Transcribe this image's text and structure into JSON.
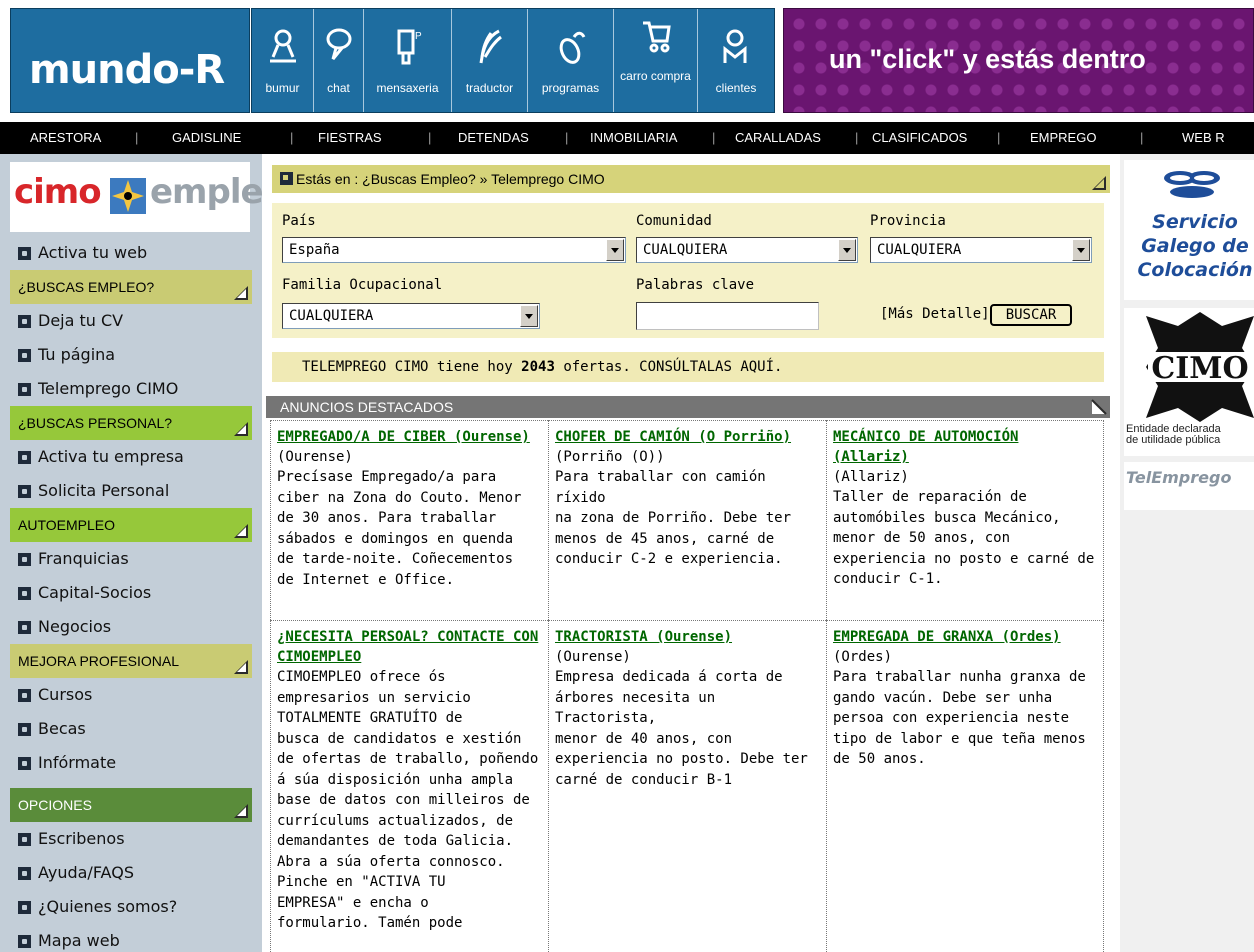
{
  "header": {
    "logo": "mundo-R",
    "apps": [
      {
        "label": "bumur",
        "icon": "microscope-icon"
      },
      {
        "label": "chat",
        "icon": "chat-balloon-icon"
      },
      {
        "label": "mensaxeria",
        "icon": "pager-icon"
      },
      {
        "label": "traductor",
        "icon": "quill-icon"
      },
      {
        "label": "programas",
        "icon": "mouse-icon"
      },
      {
        "label": "carro compra",
        "icon": "shopping-cart-icon"
      },
      {
        "label": "clientes",
        "icon": "customer-icon"
      }
    ],
    "banner": "un \"click\" y estás dentro"
  },
  "nav": [
    "ARESTORA",
    "GADISLINE",
    "FIESTRAS",
    "DETENDAS",
    "INMOBILIARIA",
    "CARALLADAS",
    "CLASIFICADOS",
    "EMPREGO",
    "WEB R"
  ],
  "sidebar": {
    "logo_left": "cimo",
    "logo_right": "empleo",
    "items": [
      {
        "type": "link",
        "label": "Activa tu web"
      },
      {
        "type": "head",
        "label": "¿BUSCAS EMPLEO?",
        "style": "olive"
      },
      {
        "type": "link",
        "label": "Deja tu CV"
      },
      {
        "type": "link",
        "label": "Tu página"
      },
      {
        "type": "link",
        "label": "Telempregо CIMO"
      },
      {
        "type": "head",
        "label": "¿BUSCAS PERSONAL?",
        "style": "green"
      },
      {
        "type": "link",
        "label": "Activa tu empresa"
      },
      {
        "type": "link",
        "label": "Solicita Personal"
      },
      {
        "type": "head",
        "label": "AUTOEMPLEO",
        "style": "green"
      },
      {
        "type": "link",
        "label": "Franquicias"
      },
      {
        "type": "link",
        "label": "Capital-Socios"
      },
      {
        "type": "link",
        "label": "Negocios"
      },
      {
        "type": "head",
        "label": "MEJORA PROFESIONAL",
        "style": "olive"
      },
      {
        "type": "link",
        "label": "Cursos"
      },
      {
        "type": "link",
        "label": "Becas"
      },
      {
        "type": "link",
        "label": "Infórmate"
      },
      {
        "type": "head",
        "label": "OPCIONES",
        "style": "dkgreen"
      },
      {
        "type": "link",
        "label": "Escribenos"
      },
      {
        "type": "link",
        "label": "Ayuda/FAQS"
      },
      {
        "type": "link",
        "label": "¿Quienes somos?"
      },
      {
        "type": "link",
        "label": "Mapa web"
      }
    ]
  },
  "breadcrumb": "Estás en : ¿Buscas Empleo? » Telempregо CIMO",
  "search": {
    "pais_label": "País",
    "pais_value": "España",
    "comunidad_label": "Comunidad",
    "comunidad_value": "CUALQUIERA",
    "provincia_label": "Provincia",
    "provincia_value": "CUALQUIERA",
    "familia_label": "Familia Ocupacional",
    "familia_value": "CUALQUIERA",
    "palabras_label": "Palabras clave",
    "palabras_value": "",
    "mas_detalle": "[Más Detalle]",
    "buscar": "BUSCAR"
  },
  "offers": {
    "prefix": "TELEMPREGO CIMO tiene hoy",
    "count": "2043",
    "suffix": "ofertas. CONSÚLTALAS AQUÍ."
  },
  "ads_title": "ANUNCIOS DESTACADOS",
  "ads": [
    {
      "title": "EMPREGADO/A DE CIBER (Ourense)",
      "location": "(Ourense)",
      "desc": "Precísase Empregado/a para\nciber na Zona do Couto. Menor\nde 30 anos. Para traballar\nsábados e domingos en quenda\nde tarde-noite. Coñecementos\nde Internet e Office."
    },
    {
      "title": "CHOFER DE CAMIÓN (O Porriño)",
      "location": "(Porriño (O))",
      "desc": "Para traballar con camión ríxido\nna zona de Porriño. Debe ter\nmenos de 45 anos, carné de\nconducir C-2 e experiencia."
    },
    {
      "title": "MECÁNICO DE AUTOMOCIÓN (Allariz)",
      "location": "(Allariz)",
      "desc": "Taller de reparación de\nautomóbiles busca Mecánico,\nmenor de 50 anos, con\nexperiencia no posto e carné de\nconducir C-1."
    },
    {
      "title": "¿NECESITA PERSOAL? CONTACTE CON CIMOEMPLEO",
      "location": "",
      "desc": "CIMOEMPLEO ofrece ós\nempresarios un servicio\nTOTALMENTE GRATUÍTO de\nbusca de candidatos e xestión\nde ofertas de traballo, poñendo\ná súa disposición unha ampla\nbase de datos con milleiros de\ncurrículums actualizados, de\ndemandantes de toda Galicia.\nAbra a súa oferta connosco.\nPinche en \"ACTIVA TU\nEMPRESA\" e encha o\nformulario. Tamén pode"
    },
    {
      "title": "TRACTORISTA (Ourense)",
      "location": "(Ourense)",
      "desc": "Empresa dedicada á corta de\nárbores necesita un Tractorista,\nmenor de 40 anos, con\nexperiencia no posto. Debe ter\ncarné de conducir B-1"
    },
    {
      "title": "EMPREGADA DE GRANXA (Ordes)",
      "location": "(Ordes)",
      "desc": "Para traballar nunha granxa de\ngando vacún. Debe ser unha\npersoa con experiencia neste\ntipo de labor e que teña menos\nde 50 anos."
    }
  ],
  "right": {
    "sgc_lines": [
      "Servicio",
      "Galego de",
      "Colocación"
    ],
    "cimo_caption": "Entidade declarada\nde utilidade pública",
    "telempleo": "TelEmprego"
  },
  "colors": {
    "header_blue": "#1e6da0",
    "banner_purple": "#6a1570",
    "sidebar_bg": "#c3ced8",
    "ad_title_green": "#006600"
  }
}
